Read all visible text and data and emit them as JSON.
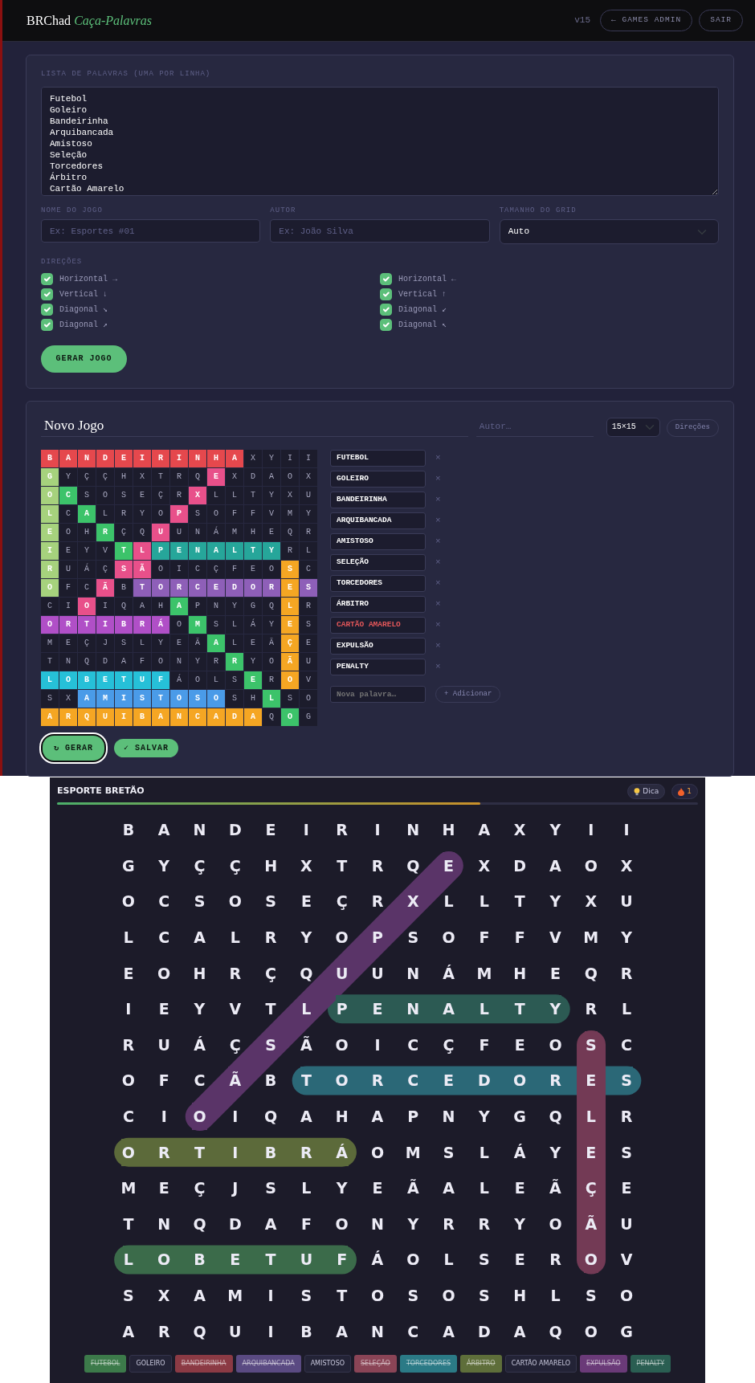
{
  "header": {
    "brand": "BRChad",
    "app_name": "Caça-Palavras",
    "version": "v15",
    "buttons": [
      "← GAMES ADMIN",
      "SAIR"
    ]
  },
  "setup": {
    "word_list": {
      "label": "LISTA DE PALAVRAS (UMA POR LINHA)",
      "value": "Futebol\nGoleiro\nBandeirinha\nArquibancada\nAmistoso\nSeleção\nTorcedores\nÁrbitro\nCartão Amarelo"
    },
    "fields": [
      {
        "kind": "input",
        "label": "NOME DO JOGO",
        "placeholder": "Ex: Esportes #01"
      },
      {
        "kind": "input",
        "label": "AUTOR",
        "placeholder": "Ex: João Silva"
      },
      {
        "kind": "select",
        "label": "TAMANHO DO GRID",
        "value": "Auto"
      }
    ],
    "directions": {
      "label": "DIREÇÕES",
      "options": [
        {
          "label": "Horizontal →",
          "checked": true
        },
        {
          "label": "Horizontal ←",
          "checked": true
        },
        {
          "label": "Vertical ↓",
          "checked": true
        },
        {
          "label": "Vertical ↑",
          "checked": true
        },
        {
          "label": "Diagonal ↘",
          "checked": true
        },
        {
          "label": "Diagonal ↙",
          "checked": true
        },
        {
          "label": "Diagonal ↗",
          "checked": true
        },
        {
          "label": "Diagonal ↖",
          "checked": true
        }
      ]
    },
    "submit": "GERAR JOGO"
  },
  "editor": {
    "title": "Novo Jogo",
    "author_placeholder": "Autor…",
    "size": "15×15",
    "directions_button": "Direções",
    "grid": [
      [
        {
          "letter": "B",
          "color": "#e5484d"
        },
        {
          "letter": "A",
          "color": "#e5484d"
        },
        {
          "letter": "N",
          "color": "#e5484d"
        },
        {
          "letter": "D",
          "color": "#e5484d"
        },
        {
          "letter": "E",
          "color": "#e5484d"
        },
        {
          "letter": "I",
          "color": "#e5484d"
        },
        {
          "letter": "R",
          "color": "#e5484d"
        },
        {
          "letter": "I",
          "color": "#e5484d"
        },
        {
          "letter": "N",
          "color": "#e5484d"
        },
        {
          "letter": "H",
          "color": "#e5484d"
        },
        {
          "letter": "A",
          "color": "#e5484d"
        },
        {
          "letter": "X"
        },
        {
          "letter": "Y"
        },
        {
          "letter": "I"
        },
        {
          "letter": "I"
        }
      ],
      [
        {
          "letter": "G",
          "color": "#a6d27d"
        },
        {
          "letter": "Y"
        },
        {
          "letter": "Ç"
        },
        {
          "letter": "Ç"
        },
        {
          "letter": "H"
        },
        {
          "letter": "X"
        },
        {
          "letter": "T"
        },
        {
          "letter": "R"
        },
        {
          "letter": "Q"
        },
        {
          "letter": "E",
          "color": "#e8508a"
        },
        {
          "letter": "X"
        },
        {
          "letter": "D"
        },
        {
          "letter": "A"
        },
        {
          "letter": "O"
        },
        {
          "letter": "X"
        }
      ],
      [
        {
          "letter": "O",
          "color": "#a6d27d"
        },
        {
          "letter": "C",
          "color": "#3cc36a"
        },
        {
          "letter": "S"
        },
        {
          "letter": "O"
        },
        {
          "letter": "S"
        },
        {
          "letter": "E"
        },
        {
          "letter": "Ç"
        },
        {
          "letter": "R"
        },
        {
          "letter": "X",
          "color": "#e8508a"
        },
        {
          "letter": "L"
        },
        {
          "letter": "L"
        },
        {
          "letter": "T"
        },
        {
          "letter": "Y"
        },
        {
          "letter": "X"
        },
        {
          "letter": "U"
        }
      ],
      [
        {
          "letter": "L",
          "color": "#a6d27d"
        },
        {
          "letter": "C"
        },
        {
          "letter": "A",
          "color": "#3cc36a"
        },
        {
          "letter": "L"
        },
        {
          "letter": "R"
        },
        {
          "letter": "Y"
        },
        {
          "letter": "O"
        },
        {
          "letter": "P",
          "color": "#e8508a"
        },
        {
          "letter": "S"
        },
        {
          "letter": "O"
        },
        {
          "letter": "F"
        },
        {
          "letter": "F"
        },
        {
          "letter": "V"
        },
        {
          "letter": "M"
        },
        {
          "letter": "Y"
        }
      ],
      [
        {
          "letter": "E",
          "color": "#a6d27d"
        },
        {
          "letter": "O"
        },
        {
          "letter": "H"
        },
        {
          "letter": "R",
          "color": "#3cc36a"
        },
        {
          "letter": "Ç"
        },
        {
          "letter": "Q"
        },
        {
          "letter": "U",
          "color": "#e8508a"
        },
        {
          "letter": "U"
        },
        {
          "letter": "N"
        },
        {
          "letter": "Á"
        },
        {
          "letter": "M"
        },
        {
          "letter": "H"
        },
        {
          "letter": "E"
        },
        {
          "letter": "Q"
        },
        {
          "letter": "R"
        }
      ],
      [
        {
          "letter": "I",
          "color": "#a6d27d"
        },
        {
          "letter": "E"
        },
        {
          "letter": "Y"
        },
        {
          "letter": "V"
        },
        {
          "letter": "T",
          "color": "#3cc36a"
        },
        {
          "letter": "L",
          "color": "#e8508a"
        },
        {
          "letter": "P",
          "color": "#26a69a"
        },
        {
          "letter": "E",
          "color": "#26a69a"
        },
        {
          "letter": "N",
          "color": "#26a69a"
        },
        {
          "letter": "A",
          "color": "#26a69a"
        },
        {
          "letter": "L",
          "color": "#26a69a"
        },
        {
          "letter": "T",
          "color": "#26a69a"
        },
        {
          "letter": "Y",
          "color": "#26a69a"
        },
        {
          "letter": "R"
        },
        {
          "letter": "L"
        }
      ],
      [
        {
          "letter": "R",
          "color": "#a6d27d"
        },
        {
          "letter": "U"
        },
        {
          "letter": "Á"
        },
        {
          "letter": "Ç"
        },
        {
          "letter": "S",
          "color": "#e8508a"
        },
        {
          "letter": "Ã",
          "color": "#e8508a"
        },
        {
          "letter": "O"
        },
        {
          "letter": "I"
        },
        {
          "letter": "C"
        },
        {
          "letter": "Ç"
        },
        {
          "letter": "F"
        },
        {
          "letter": "E"
        },
        {
          "letter": "O"
        },
        {
          "letter": "S",
          "color": "#f5a623"
        },
        {
          "letter": "C"
        }
      ],
      [
        {
          "letter": "O",
          "color": "#a6d27d"
        },
        {
          "letter": "F"
        },
        {
          "letter": "C"
        },
        {
          "letter": "Ã",
          "color": "#e8508a"
        },
        {
          "letter": "B"
        },
        {
          "letter": "T",
          "color": "#8e5fb8"
        },
        {
          "letter": "O",
          "color": "#8e5fb8"
        },
        {
          "letter": "R",
          "color": "#8e5fb8"
        },
        {
          "letter": "C",
          "color": "#8e5fb8"
        },
        {
          "letter": "E",
          "color": "#8e5fb8"
        },
        {
          "letter": "D",
          "color": "#8e5fb8"
        },
        {
          "letter": "O",
          "color": "#8e5fb8"
        },
        {
          "letter": "R",
          "color": "#8e5fb8"
        },
        {
          "letter": "E",
          "color": "#f5a623"
        },
        {
          "letter": "S",
          "color": "#8e5fb8"
        }
      ],
      [
        {
          "letter": "C"
        },
        {
          "letter": "I"
        },
        {
          "letter": "O",
          "color": "#e8508a"
        },
        {
          "letter": "I"
        },
        {
          "letter": "Q"
        },
        {
          "letter": "A"
        },
        {
          "letter": "H"
        },
        {
          "letter": "A",
          "color": "#3cc36a"
        },
        {
          "letter": "P"
        },
        {
          "letter": "N"
        },
        {
          "letter": "Y"
        },
        {
          "letter": "G"
        },
        {
          "letter": "Q"
        },
        {
          "letter": "L",
          "color": "#f5a623"
        },
        {
          "letter": "R"
        }
      ],
      [
        {
          "letter": "O",
          "color": "#b04fc7"
        },
        {
          "letter": "R",
          "color": "#b04fc7"
        },
        {
          "letter": "T",
          "color": "#b04fc7"
        },
        {
          "letter": "I",
          "color": "#b04fc7"
        },
        {
          "letter": "B",
          "color": "#b04fc7"
        },
        {
          "letter": "R",
          "color": "#b04fc7"
        },
        {
          "letter": "Á",
          "color": "#b04fc7"
        },
        {
          "letter": "O"
        },
        {
          "letter": "M",
          "color": "#3cc36a"
        },
        {
          "letter": "S"
        },
        {
          "letter": "L"
        },
        {
          "letter": "Á"
        },
        {
          "letter": "Y"
        },
        {
          "letter": "E",
          "color": "#f5a623"
        },
        {
          "letter": "S"
        }
      ],
      [
        {
          "letter": "M"
        },
        {
          "letter": "E"
        },
        {
          "letter": "Ç"
        },
        {
          "letter": "J"
        },
        {
          "letter": "S"
        },
        {
          "letter": "L"
        },
        {
          "letter": "Y"
        },
        {
          "letter": "E"
        },
        {
          "letter": "Ã"
        },
        {
          "letter": "A",
          "color": "#3cc36a"
        },
        {
          "letter": "L"
        },
        {
          "letter": "E"
        },
        {
          "letter": "Ã"
        },
        {
          "letter": "Ç",
          "color": "#f5a623"
        },
        {
          "letter": "E"
        }
      ],
      [
        {
          "letter": "T"
        },
        {
          "letter": "N"
        },
        {
          "letter": "Q"
        },
        {
          "letter": "D"
        },
        {
          "letter": "A"
        },
        {
          "letter": "F"
        },
        {
          "letter": "O"
        },
        {
          "letter": "N"
        },
        {
          "letter": "Y"
        },
        {
          "letter": "R"
        },
        {
          "letter": "R",
          "color": "#3cc36a"
        },
        {
          "letter": "Y"
        },
        {
          "letter": "O"
        },
        {
          "letter": "Ã",
          "color": "#f5a623"
        },
        {
          "letter": "U"
        }
      ],
      [
        {
          "letter": "L",
          "color": "#26c0d8"
        },
        {
          "letter": "O",
          "color": "#26c0d8"
        },
        {
          "letter": "B",
          "color": "#26c0d8"
        },
        {
          "letter": "E",
          "color": "#26c0d8"
        },
        {
          "letter": "T",
          "color": "#26c0d8"
        },
        {
          "letter": "U",
          "color": "#26c0d8"
        },
        {
          "letter": "F",
          "color": "#26c0d8"
        },
        {
          "letter": "Á"
        },
        {
          "letter": "O"
        },
        {
          "letter": "L"
        },
        {
          "letter": "S"
        },
        {
          "letter": "E",
          "color": "#3cc36a"
        },
        {
          "letter": "R"
        },
        {
          "letter": "O",
          "color": "#f5a623"
        },
        {
          "letter": "V"
        }
      ],
      [
        {
          "letter": "S"
        },
        {
          "letter": "X"
        },
        {
          "letter": "A",
          "color": "#4a9be8"
        },
        {
          "letter": "M",
          "color": "#4a9be8"
        },
        {
          "letter": "I",
          "color": "#4a9be8"
        },
        {
          "letter": "S",
          "color": "#4a9be8"
        },
        {
          "letter": "T",
          "color": "#4a9be8"
        },
        {
          "letter": "O",
          "color": "#4a9be8"
        },
        {
          "letter": "S",
          "color": "#4a9be8"
        },
        {
          "letter": "O",
          "color": "#4a9be8"
        },
        {
          "letter": "S"
        },
        {
          "letter": "H"
        },
        {
          "letter": "L",
          "color": "#3cc36a"
        },
        {
          "letter": "S"
        },
        {
          "letter": "O"
        }
      ],
      [
        {
          "letter": "A",
          "color": "#f5a623"
        },
        {
          "letter": "R",
          "color": "#f5a623"
        },
        {
          "letter": "Q",
          "color": "#f5a623"
        },
        {
          "letter": "U",
          "color": "#f5a623"
        },
        {
          "letter": "I",
          "color": "#f5a623"
        },
        {
          "letter": "B",
          "color": "#f5a623"
        },
        {
          "letter": "A",
          "color": "#f5a623"
        },
        {
          "letter": "N",
          "color": "#f5a623"
        },
        {
          "letter": "C",
          "color": "#f5a623"
        },
        {
          "letter": "A",
          "color": "#f5a623"
        },
        {
          "letter": "D",
          "color": "#f5a623"
        },
        {
          "letter": "A",
          "color": "#f5a623"
        },
        {
          "letter": "Q"
        },
        {
          "letter": "O",
          "color": "#3cc36a"
        },
        {
          "letter": "G"
        }
      ]
    ],
    "words": [
      {
        "text": "FUTEBOL",
        "error": false,
        "remove": "×"
      },
      {
        "text": "GOLEIRO",
        "error": false,
        "remove": "×"
      },
      {
        "text": "BANDEIRINHA",
        "error": false,
        "remove": "×"
      },
      {
        "text": "ARQUIBANCADA",
        "error": false,
        "remove": "×"
      },
      {
        "text": "AMISTOSO",
        "error": false,
        "remove": "×"
      },
      {
        "text": "SELEÇÃO",
        "error": false,
        "remove": "×"
      },
      {
        "text": "TORCEDORES",
        "error": false,
        "remove": "×"
      },
      {
        "text": "ÁRBITRO",
        "error": false,
        "remove": "×"
      },
      {
        "text": "CARTÃO AMARELO",
        "error": true,
        "remove": "×"
      },
      {
        "text": "EXPULSÃO",
        "error": false,
        "remove": "×"
      },
      {
        "text": "PENALTY",
        "error": false,
        "remove": "×"
      }
    ],
    "new_word_placeholder": "Nova palavra…",
    "add_button": "+ Adicionar",
    "actions": [
      {
        "label": "↻ GERAR",
        "focused": true
      },
      {
        "label": "✓ SALVAR",
        "focused": false
      }
    ]
  },
  "game": {
    "title": "ESPORTE BRETÃO",
    "hint_button": "Dica",
    "streak": "1",
    "progress": {
      "level": 0.66
    },
    "board": [
      [
        {
          "letter": "B"
        },
        {
          "letter": "A"
        },
        {
          "letter": "N"
        },
        {
          "letter": "D"
        },
        {
          "letter": "E"
        },
        {
          "letter": "I"
        },
        {
          "letter": "R"
        },
        {
          "letter": "I"
        },
        {
          "letter": "N"
        },
        {
          "letter": "H"
        },
        {
          "letter": "A"
        },
        {
          "letter": "X"
        },
        {
          "letter": "Y"
        },
        {
          "letter": "I"
        },
        {
          "letter": "I"
        }
      ],
      [
        {
          "letter": "G"
        },
        {
          "letter": "Y"
        },
        {
          "letter": "Ç"
        },
        {
          "letter": "Ç"
        },
        {
          "letter": "H"
        },
        {
          "letter": "X"
        },
        {
          "letter": "T"
        },
        {
          "letter": "R"
        },
        {
          "letter": "Q"
        },
        {
          "letter": "E",
          "color": "#5a3468"
        },
        {
          "letter": "X"
        },
        {
          "letter": "D"
        },
        {
          "letter": "A"
        },
        {
          "letter": "O"
        },
        {
          "letter": "X"
        }
      ],
      [
        {
          "letter": "O"
        },
        {
          "letter": "C"
        },
        {
          "letter": "S"
        },
        {
          "letter": "O"
        },
        {
          "letter": "S"
        },
        {
          "letter": "E"
        },
        {
          "letter": "Ç"
        },
        {
          "letter": "R"
        },
        {
          "letter": "X",
          "color": "#5a3468"
        },
        {
          "letter": "L"
        },
        {
          "letter": "L"
        },
        {
          "letter": "T"
        },
        {
          "letter": "Y"
        },
        {
          "letter": "X"
        },
        {
          "letter": "U"
        }
      ],
      [
        {
          "letter": "L"
        },
        {
          "letter": "C"
        },
        {
          "letter": "A"
        },
        {
          "letter": "L"
        },
        {
          "letter": "R"
        },
        {
          "letter": "Y"
        },
        {
          "letter": "O"
        },
        {
          "letter": "P",
          "color": "#5a3468"
        },
        {
          "letter": "S"
        },
        {
          "letter": "O"
        },
        {
          "letter": "F"
        },
        {
          "letter": "F"
        },
        {
          "letter": "V"
        },
        {
          "letter": "M"
        },
        {
          "letter": "Y"
        }
      ],
      [
        {
          "letter": "E"
        },
        {
          "letter": "O"
        },
        {
          "letter": "H"
        },
        {
          "letter": "R"
        },
        {
          "letter": "Ç"
        },
        {
          "letter": "Q"
        },
        {
          "letter": "U",
          "color": "#5a3468"
        },
        {
          "letter": "U"
        },
        {
          "letter": "N"
        },
        {
          "letter": "Á"
        },
        {
          "letter": "M"
        },
        {
          "letter": "H"
        },
        {
          "letter": "E"
        },
        {
          "letter": "Q"
        },
        {
          "letter": "R"
        }
      ],
      [
        {
          "letter": "I"
        },
        {
          "letter": "E"
        },
        {
          "letter": "Y"
        },
        {
          "letter": "V"
        },
        {
          "letter": "T"
        },
        {
          "letter": "L",
          "color": "#5a3468"
        },
        {
          "letter": "P",
          "color": "#2c5a53"
        },
        {
          "letter": "E",
          "color": "#2c5a53"
        },
        {
          "letter": "N",
          "color": "#2c5a53"
        },
        {
          "letter": "A",
          "color": "#2c5a53"
        },
        {
          "letter": "L",
          "color": "#2c5a53"
        },
        {
          "letter": "T",
          "color": "#2c5a53"
        },
        {
          "letter": "Y",
          "color": "#2c5a53"
        },
        {
          "letter": "R"
        },
        {
          "letter": "L"
        }
      ],
      [
        {
          "letter": "R"
        },
        {
          "letter": "U"
        },
        {
          "letter": "Á"
        },
        {
          "letter": "Ç"
        },
        {
          "letter": "S",
          "color": "#5a3468"
        },
        {
          "letter": "Ã"
        },
        {
          "letter": "O"
        },
        {
          "letter": "I"
        },
        {
          "letter": "C"
        },
        {
          "letter": "Ç"
        },
        {
          "letter": "F"
        },
        {
          "letter": "E"
        },
        {
          "letter": "O"
        },
        {
          "letter": "S",
          "color": "#733a55"
        },
        {
          "letter": "C"
        }
      ],
      [
        {
          "letter": "O"
        },
        {
          "letter": "F"
        },
        {
          "letter": "C"
        },
        {
          "letter": "Ã",
          "color": "#5a3468"
        },
        {
          "letter": "B"
        },
        {
          "letter": "T",
          "color": "#2b6877"
        },
        {
          "letter": "O",
          "color": "#2b6877"
        },
        {
          "letter": "R",
          "color": "#2b6877"
        },
        {
          "letter": "C",
          "color": "#2b6877"
        },
        {
          "letter": "E",
          "color": "#2b6877"
        },
        {
          "letter": "D",
          "color": "#2b6877"
        },
        {
          "letter": "O",
          "color": "#2b6877"
        },
        {
          "letter": "R",
          "color": "#2b6877"
        },
        {
          "letter": "E",
          "color": "#733a55"
        },
        {
          "letter": "S",
          "color": "#2b6877"
        }
      ],
      [
        {
          "letter": "C"
        },
        {
          "letter": "I"
        },
        {
          "letter": "O",
          "color": "#5a3468"
        },
        {
          "letter": "I"
        },
        {
          "letter": "Q"
        },
        {
          "letter": "A"
        },
        {
          "letter": "H"
        },
        {
          "letter": "A"
        },
        {
          "letter": "P"
        },
        {
          "letter": "N"
        },
        {
          "letter": "Y"
        },
        {
          "letter": "G"
        },
        {
          "letter": "Q"
        },
        {
          "letter": "L",
          "color": "#733a55"
        },
        {
          "letter": "R"
        }
      ],
      [
        {
          "letter": "O",
          "color": "#5c6a3a"
        },
        {
          "letter": "R",
          "color": "#5c6a3a"
        },
        {
          "letter": "T",
          "color": "#5c6a3a"
        },
        {
          "letter": "I",
          "color": "#5c6a3a"
        },
        {
          "letter": "B",
          "color": "#5c6a3a"
        },
        {
          "letter": "R",
          "color": "#5c6a3a"
        },
        {
          "letter": "Á",
          "color": "#5c6a3a"
        },
        {
          "letter": "O"
        },
        {
          "letter": "M"
        },
        {
          "letter": "S"
        },
        {
          "letter": "L"
        },
        {
          "letter": "Á"
        },
        {
          "letter": "Y"
        },
        {
          "letter": "E",
          "color": "#733a55"
        },
        {
          "letter": "S"
        }
      ],
      [
        {
          "letter": "M"
        },
        {
          "letter": "E"
        },
        {
          "letter": "Ç"
        },
        {
          "letter": "J"
        },
        {
          "letter": "S"
        },
        {
          "letter": "L"
        },
        {
          "letter": "Y"
        },
        {
          "letter": "E"
        },
        {
          "letter": "Ã"
        },
        {
          "letter": "A"
        },
        {
          "letter": "L"
        },
        {
          "letter": "E"
        },
        {
          "letter": "Ã"
        },
        {
          "letter": "Ç",
          "color": "#733a55"
        },
        {
          "letter": "E"
        }
      ],
      [
        {
          "letter": "T"
        },
        {
          "letter": "N"
        },
        {
          "letter": "Q"
        },
        {
          "letter": "D"
        },
        {
          "letter": "A"
        },
        {
          "letter": "F"
        },
        {
          "letter": "O"
        },
        {
          "letter": "N"
        },
        {
          "letter": "Y"
        },
        {
          "letter": "R"
        },
        {
          "letter": "R"
        },
        {
          "letter": "Y"
        },
        {
          "letter": "O"
        },
        {
          "letter": "Ã",
          "color": "#733a55"
        },
        {
          "letter": "U"
        }
      ],
      [
        {
          "letter": "L",
          "color": "#3b6b4a"
        },
        {
          "letter": "O",
          "color": "#3b6b4a"
        },
        {
          "letter": "B",
          "color": "#3b6b4a"
        },
        {
          "letter": "E",
          "color": "#3b6b4a"
        },
        {
          "letter": "T",
          "color": "#3b6b4a"
        },
        {
          "letter": "U",
          "color": "#3b6b4a"
        },
        {
          "letter": "F",
          "color": "#3b6b4a"
        },
        {
          "letter": "Á"
        },
        {
          "letter": "O"
        },
        {
          "letter": "L"
        },
        {
          "letter": "S"
        },
        {
          "letter": "E"
        },
        {
          "letter": "R"
        },
        {
          "letter": "O",
          "color": "#733a55"
        },
        {
          "letter": "V"
        }
      ],
      [
        {
          "letter": "S"
        },
        {
          "letter": "X"
        },
        {
          "letter": "A"
        },
        {
          "letter": "M"
        },
        {
          "letter": "I"
        },
        {
          "letter": "S"
        },
        {
          "letter": "T"
        },
        {
          "letter": "O"
        },
        {
          "letter": "S"
        },
        {
          "letter": "O"
        },
        {
          "letter": "S"
        },
        {
          "letter": "H"
        },
        {
          "letter": "L"
        },
        {
          "letter": "S"
        },
        {
          "letter": "O"
        }
      ],
      [
        {
          "letter": "A"
        },
        {
          "letter": "R"
        },
        {
          "letter": "Q"
        },
        {
          "letter": "U"
        },
        {
          "letter": "I"
        },
        {
          "letter": "B"
        },
        {
          "letter": "A"
        },
        {
          "letter": "N"
        },
        {
          "letter": "C"
        },
        {
          "letter": "A"
        },
        {
          "letter": "D"
        },
        {
          "letter": "A"
        },
        {
          "letter": "Q"
        },
        {
          "letter": "O"
        },
        {
          "letter": "G"
        }
      ]
    ],
    "chips": [
      {
        "text": "FUTEBOL",
        "found": true,
        "color": "#3c7a4a"
      },
      {
        "text": "GOLEIRO",
        "found": false
      },
      {
        "text": "BANDEIRINHA",
        "found": true,
        "color": "#8b3a44"
      },
      {
        "text": "ARQUIBANCADA",
        "found": true,
        "color": "#5a4a82"
      },
      {
        "text": "AMISTOSO",
        "found": false
      },
      {
        "text": "SELEÇÃO",
        "found": true,
        "color": "#8a4456"
      },
      {
        "text": "TORCEDORES",
        "found": true,
        "color": "#2b7a86"
      },
      {
        "text": "ÁRBITRO",
        "found": true,
        "color": "#5e6e3a"
      },
      {
        "text": "CARTÃO AMARELO",
        "found": false
      },
      {
        "text": "EXPULSÃO",
        "found": true,
        "color": "#6a3a78"
      },
      {
        "text": "PENALTY",
        "found": true,
        "color": "#2a5e52"
      }
    ]
  }
}
